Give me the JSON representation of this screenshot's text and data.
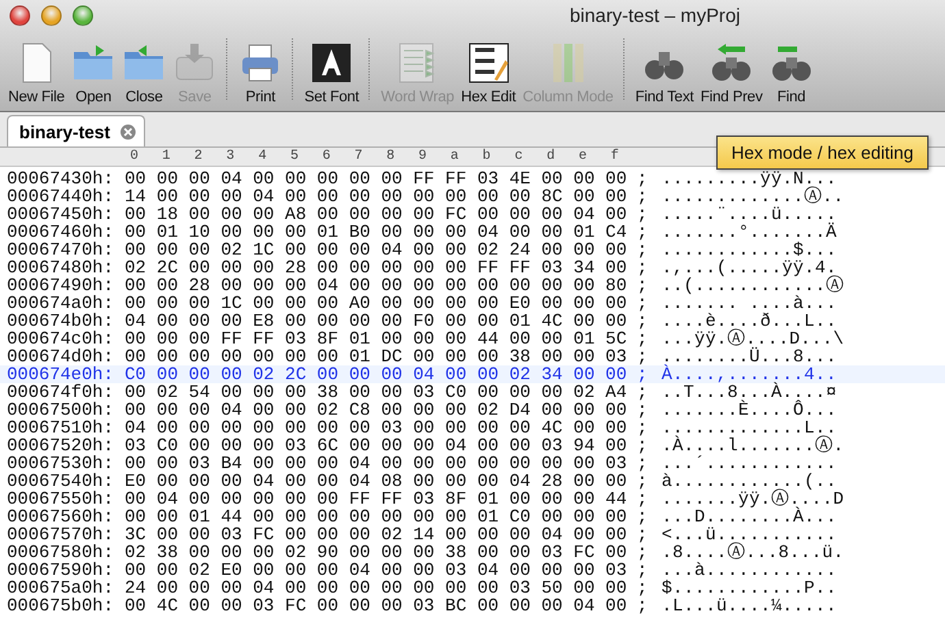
{
  "window": {
    "title": "binary-test – myProj"
  },
  "toolbar": [
    {
      "kind": "button",
      "label": "New File",
      "disabled": false
    },
    {
      "kind": "button",
      "label": "Open",
      "disabled": false
    },
    {
      "kind": "button",
      "label": "Close",
      "disabled": false
    },
    {
      "kind": "button",
      "label": "Save",
      "disabled": true
    },
    {
      "kind": "separator"
    },
    {
      "kind": "button",
      "label": "Print",
      "disabled": false
    },
    {
      "kind": "separator"
    },
    {
      "kind": "button",
      "label": "Set Font",
      "disabled": false
    },
    {
      "kind": "separator"
    },
    {
      "kind": "button",
      "label": "Word Wrap",
      "disabled": true
    },
    {
      "kind": "button",
      "label": "Hex Edit",
      "disabled": false
    },
    {
      "kind": "button",
      "label": "Column Mode",
      "disabled": true
    },
    {
      "kind": "separator"
    },
    {
      "kind": "button",
      "label": "Find Text",
      "disabled": false
    },
    {
      "kind": "button",
      "label": "Find Prev",
      "disabled": false
    },
    {
      "kind": "button",
      "label": "Find",
      "disabled": false
    }
  ],
  "tabs": [
    {
      "label": "binary-test",
      "selected": true
    }
  ],
  "tooltip": "Hex mode / hex editing",
  "columns": [
    "0",
    "1",
    "2",
    "3",
    "4",
    "5",
    "6",
    "7",
    "8",
    "9",
    "a",
    "b",
    "c",
    "d",
    "e",
    "f"
  ],
  "rows": [
    {
      "address": "00067430h:",
      "bytes": "00 00 00 04 00 00 00 00 00 FF FF 03 4E 00 00 00",
      "separator": ";",
      "ascii": ".........ÿÿ.N...",
      "selected": false
    },
    {
      "address": "00067440h:",
      "bytes": "14 00 00 00 04 00 00 00 00 00 00 00 00 8C 00 00",
      "separator": ";",
      "ascii": ".............Ⓐ..",
      "selected": false
    },
    {
      "address": "00067450h:",
      "bytes": "00 18 00 00 00 A8 00 00 00 00 FC 00 00 00 04 00",
      "separator": ";",
      "ascii": ".....¨....ü.....",
      "selected": false
    },
    {
      "address": "00067460h:",
      "bytes": "00 01 10 00 00 00 01 B0 00 00 00 04 00 00 01 C4",
      "separator": ";",
      "ascii": ".......°.......Ä",
      "selected": false
    },
    {
      "address": "00067470h:",
      "bytes": "00 00 00 02 1C 00 00 00 04 00 00 02 24 00 00 00",
      "separator": ";",
      "ascii": "............$...",
      "selected": false
    },
    {
      "address": "00067480h:",
      "bytes": "02 2C 00 00 00 28 00 00 00 00 00 FF FF 03 34 00",
      "separator": ";",
      "ascii": ".,...(.....ÿÿ.4.",
      "selected": false
    },
    {
      "address": "00067490h:",
      "bytes": "00 00 28 00 00 00 04 00 00 00 00 00 00 00 00 80",
      "separator": ";",
      "ascii": "..(............Ⓐ",
      "selected": false
    },
    {
      "address": "000674a0h:",
      "bytes": "00 00 00 1C 00 00 00 A0 00 00 00 00 E0 00 00 00",
      "separator": ";",
      "ascii": "....... ....à...",
      "selected": false
    },
    {
      "address": "000674b0h:",
      "bytes": "04 00 00 00 E8 00 00 00 00 F0 00 00 01 4C 00 00",
      "separator": ";",
      "ascii": "....è....ð...L..",
      "selected": false
    },
    {
      "address": "000674c0h:",
      "bytes": "00 00 00 FF FF 03 8F 01 00 00 00 44 00 00 01 5C",
      "separator": ";",
      "ascii": "...ÿÿ.Ⓐ....D...\\",
      "selected": false
    },
    {
      "address": "000674d0h:",
      "bytes": "00 00 00 00 00 00 00 01 DC 00 00 00 38 00 00 03",
      "separator": ";",
      "ascii": "........Ü...8...",
      "selected": false
    },
    {
      "address": "000674e0h:",
      "bytes": "C0 00 00 00 02 2C 00 00 00 04 00 00 02 34 00 00",
      "separator": ";",
      "ascii": "À....,.......4..",
      "selected": true
    },
    {
      "address": "000674f0h:",
      "bytes": "00 02 54 00 00 00 38 00 00 03 C0 00 00 00 02 A4",
      "separator": ";",
      "ascii": "..T...8...À....¤",
      "selected": false
    },
    {
      "address": "00067500h:",
      "bytes": "00 00 00 04 00 00 02 C8 00 00 00 02 D4 00 00 00",
      "separator": ";",
      "ascii": ".......È....Ô...",
      "selected": false
    },
    {
      "address": "00067510h:",
      "bytes": "04 00 00 00 00 00 00 00 03 00 00 00 00 4C 00 00",
      "separator": ";",
      "ascii": ".............L..",
      "selected": false
    },
    {
      "address": "00067520h:",
      "bytes": "03 C0 00 00 00 03 6C 00 00 00 04 00 00 03 94 00",
      "separator": ";",
      "ascii": ".À....l.......Ⓐ.",
      "selected": false
    },
    {
      "address": "00067530h:",
      "bytes": "00 00 03 B4 00 00 00 04 00 00 00 00 00 00 00 03",
      "separator": ";",
      "ascii": "...´............",
      "selected": false
    },
    {
      "address": "00067540h:",
      "bytes": "E0 00 00 00 04 00 00 04 08 00 00 00 04 28 00 00",
      "separator": ";",
      "ascii": "à............(..",
      "selected": false
    },
    {
      "address": "00067550h:",
      "bytes": "00 04 00 00 00 00 00 FF FF 03 8F 01 00 00 00 44",
      "separator": ";",
      "ascii": ".......ÿÿ.Ⓐ....D",
      "selected": false
    },
    {
      "address": "00067560h:",
      "bytes": "00 00 01 44 00 00 00 00 00 00 00 01 C0 00 00 00",
      "separator": ";",
      "ascii": "...D........À...",
      "selected": false
    },
    {
      "address": "00067570h:",
      "bytes": "3C 00 00 03 FC 00 00 00 02 14 00 00 00 04 00 00",
      "separator": ";",
      "ascii": "<...ü...........",
      "selected": false
    },
    {
      "address": "00067580h:",
      "bytes": "02 38 00 00 00 02 90 00 00 00 38 00 00 03 FC 00",
      "separator": ";",
      "ascii": ".8....Ⓐ...8...ü.",
      "selected": false
    },
    {
      "address": "00067590h:",
      "bytes": "00 00 02 E0 00 00 00 04 00 00 03 04 00 00 00 03",
      "separator": ";",
      "ascii": "...à............",
      "selected": false
    },
    {
      "address": "000675a0h:",
      "bytes": "24 00 00 00 04 00 00 00 00 00 00 00 03 50 00 00",
      "separator": ";",
      "ascii": "$............P..",
      "selected": false
    },
    {
      "address": "000675b0h:",
      "bytes": "00 4C 00 00 03 FC 00 00 00 03 BC 00 00 00 04 00",
      "separator": ";",
      "ascii": ".L...ü....¼.....",
      "selected": false
    }
  ]
}
